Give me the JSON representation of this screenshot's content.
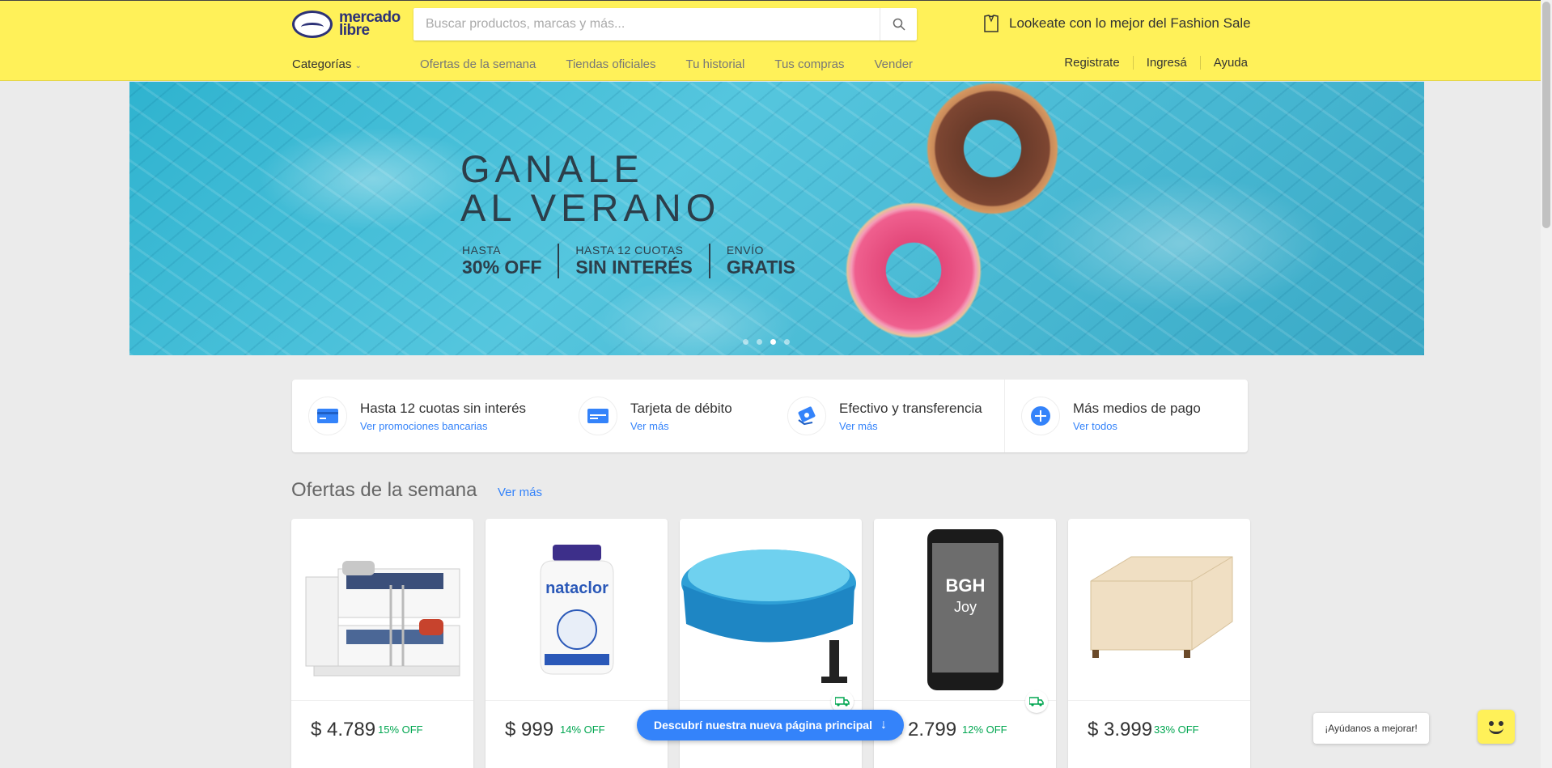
{
  "header": {
    "logo_text": "mercado libre",
    "search_placeholder": "Buscar productos, marcas y más...",
    "promo_text": "Lookeate con lo mejor del Fashion Sale",
    "nav_categories": "Categorías",
    "nav_items": [
      "Ofertas de la semana",
      "Tiendas oficiales",
      "Tu historial",
      "Tus compras",
      "Vender"
    ],
    "account_links": [
      "Registrate",
      "Ingresá",
      "Ayuda"
    ]
  },
  "hero": {
    "title_line1": "GANALE",
    "title_line2": "AL VERANO",
    "offers": [
      {
        "top": "HASTA",
        "bottom": "30% OFF"
      },
      {
        "top": "HASTA 12 CUOTAS",
        "bottom": "SIN INTERÉS"
      },
      {
        "top": "ENVÍO",
        "bottom": "GRATIS"
      }
    ],
    "slide_count": 4,
    "active_slide": 3
  },
  "payments": [
    {
      "title": "Hasta 12 cuotas sin interés",
      "link": "Ver promociones bancarias",
      "icon": "credit-card-icon"
    },
    {
      "title": "Tarjeta de débito",
      "link": "Ver más",
      "icon": "debit-card-icon"
    },
    {
      "title": "Efectivo y transferencia",
      "link": "Ver más",
      "icon": "cash-icon"
    },
    {
      "title": "Más medios de pago",
      "link": "Ver todos",
      "icon": "plus-icon"
    }
  ],
  "offers_section": {
    "title": "Ofertas de la semana",
    "link": "Ver más",
    "products": [
      {
        "price": "$ 4.789",
        "discount": "15% OFF",
        "image": "bunk-bed",
        "free_shipping": false
      },
      {
        "price": "$ 999",
        "discount": "14% OFF",
        "image": "pool-chlorine",
        "free_shipping": false
      },
      {
        "price": "",
        "discount": "",
        "image": "inflatable-pool",
        "free_shipping": true
      },
      {
        "price": "$ 2.799",
        "discount": "12% OFF",
        "image": "bgh-joy-phone",
        "free_shipping": true
      },
      {
        "price": "$ 3.999",
        "discount": "33% OFF",
        "image": "mattress",
        "free_shipping": false
      }
    ]
  },
  "floating": {
    "new_home_label": "Descubrí nuestra nueva página principal",
    "feedback_label": "¡Ayúdanos a mejorar!"
  },
  "colors": {
    "header_bg": "#fff159",
    "link": "#3483fa",
    "discount": "#00a650",
    "brand_blue": "#2d3277"
  }
}
